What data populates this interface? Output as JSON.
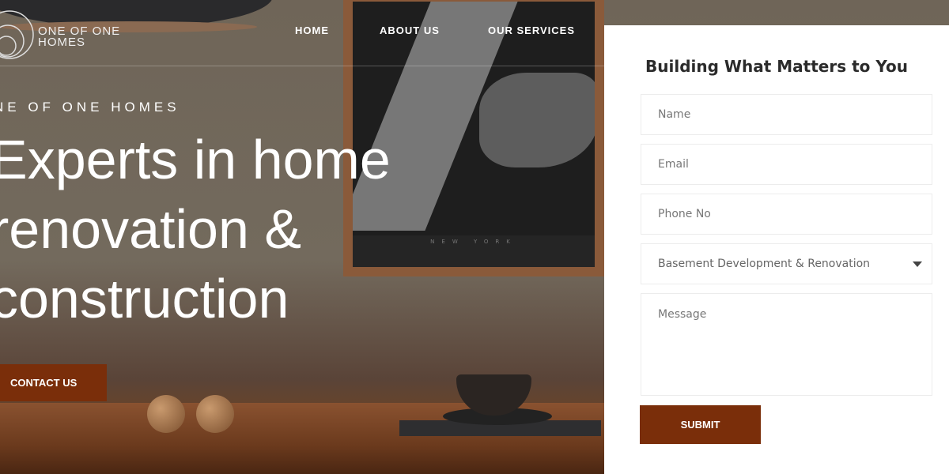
{
  "brand": {
    "line1": "ONE OF ONE",
    "line2": "HOMES"
  },
  "nav": {
    "items": [
      {
        "label": "HOME"
      },
      {
        "label": "ABOUT US"
      },
      {
        "label": "OUR SERVICES"
      }
    ]
  },
  "hero": {
    "eyebrow": "NE OF ONE HOMES",
    "headline": [
      "Experts in home",
      "renovation &",
      "construction"
    ],
    "cta_label": "CONTACT US",
    "map_caption": "NEW YORK"
  },
  "form": {
    "title": "Building What Matters to You",
    "name_placeholder": "Name",
    "email_placeholder": "Email",
    "phone_placeholder": "Phone No",
    "service_selected": "Basement Development & Renovation",
    "message_placeholder": "Message",
    "submit_label": "SUBMIT"
  },
  "colors": {
    "accent": "#7a2e0a"
  }
}
